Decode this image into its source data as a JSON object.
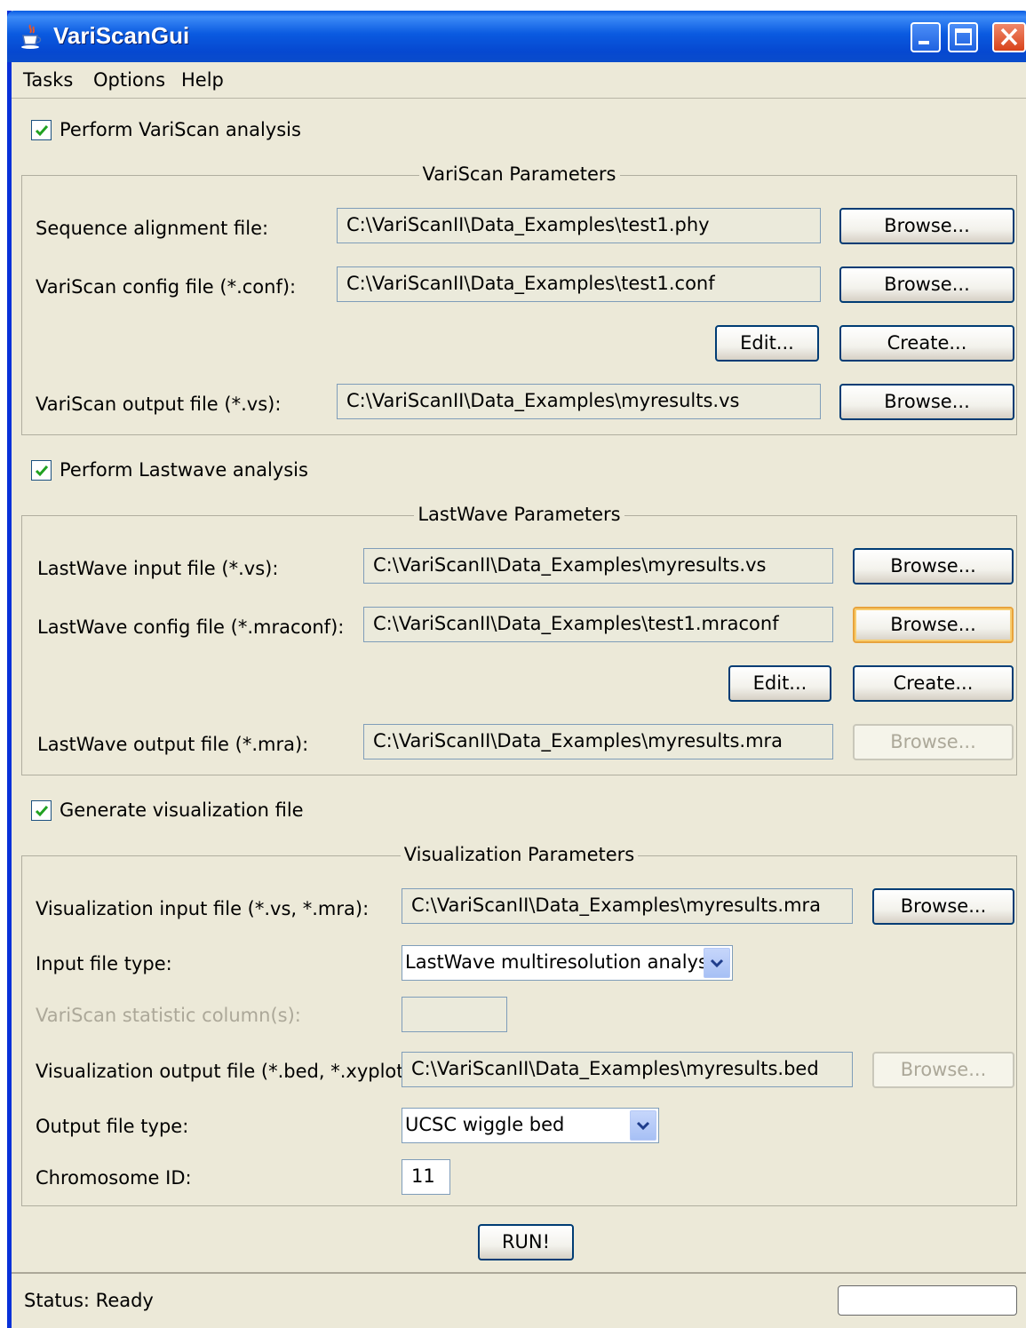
{
  "window": {
    "title": "VariScanGui"
  },
  "menubar": {
    "items": [
      "Tasks",
      "Options",
      "Help"
    ]
  },
  "variscan": {
    "checkbox_label": "Perform VariScan analysis",
    "checked": true,
    "group_title": "VariScan Parameters",
    "seq_label": "Sequence alignment file:",
    "seq_value": "C:\\VariScanII\\Data_Examples\\test1.phy",
    "config_label": "VariScan config file (*.conf):",
    "config_value": "C:\\VariScanII\\Data_Examples\\test1.conf",
    "output_label": "VariScan output file (*.vs):",
    "output_value": "C:\\VariScanII\\Data_Examples\\myresults.vs"
  },
  "lastwave": {
    "checkbox_label": "Perform Lastwave analysis",
    "checked": true,
    "group_title": "LastWave Parameters",
    "input_label": "LastWave input file (*.vs):",
    "input_value": "C:\\VariScanII\\Data_Examples\\myresults.vs",
    "config_label": "LastWave config file (*.mraconf):",
    "config_value": "C:\\VariScanII\\Data_Examples\\test1.mraconf",
    "output_label": "LastWave output file (*.mra):",
    "output_value": "C:\\VariScanII\\Data_Examples\\myresults.mra"
  },
  "visualization": {
    "checkbox_label": "Generate visualization file",
    "checked": true,
    "group_title": "Visualization Parameters",
    "input_label": "Visualization input file (*.vs, *.mra):",
    "input_value": "C:\\VariScanII\\Data_Examples\\myresults.mra",
    "input_type_label": "Input file type:",
    "input_type_value": "LastWave multiresolution analysis",
    "stat_col_label": "VariScan statistic column(s):",
    "stat_col_value": "",
    "output_label": "Visualization output file (*.bed, *.xyplot):",
    "output_value": "C:\\VariScanII\\Data_Examples\\myresults.bed",
    "output_type_label": "Output file type:",
    "output_type_value": "UCSC wiggle bed",
    "chrom_label": "Chromosome ID:",
    "chrom_value": "11"
  },
  "buttons": {
    "browse": "Browse...",
    "edit": "Edit...",
    "create": "Create...",
    "run": "RUN!"
  },
  "status": {
    "text": "Status: Ready"
  },
  "colors": {
    "titlebar": "#0a5de3",
    "window_bg": "#ece9d8",
    "field_border": "#7f9db9",
    "button_border": "#003c74",
    "focus": "#e8a33c"
  }
}
